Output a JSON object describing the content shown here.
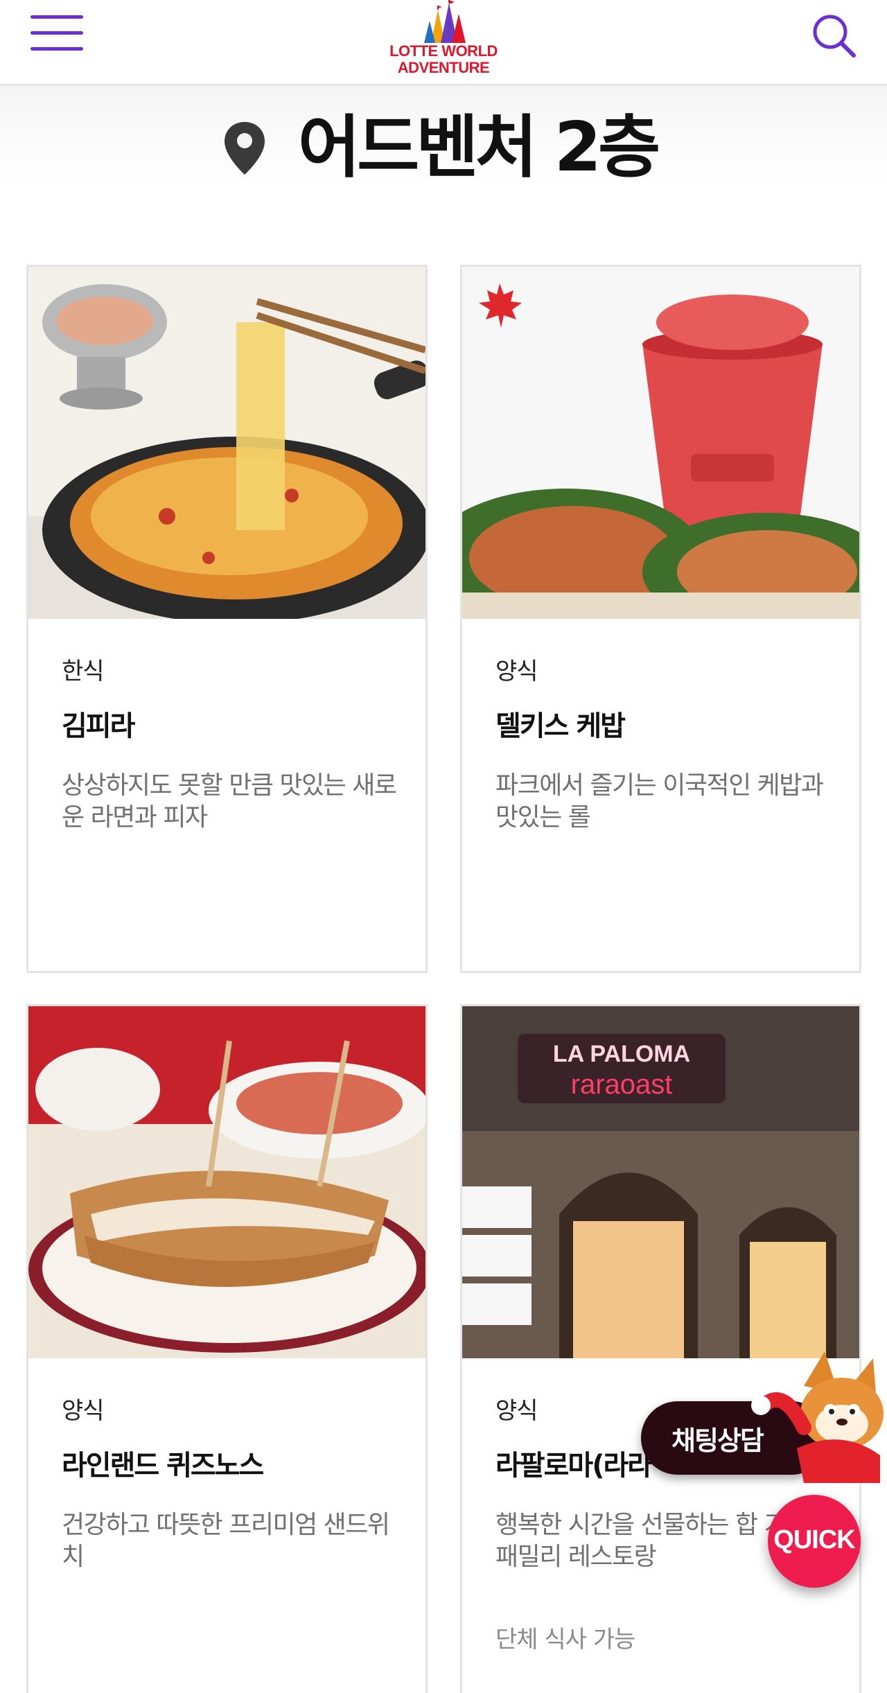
{
  "header": {
    "logo_line1": "LOTTE WORLD",
    "logo_line2": "ADVENTURE",
    "menu_icon": "hamburger-menu-icon",
    "search_icon": "search-icon"
  },
  "page": {
    "title": "어드벤처 2층",
    "title_icon": "location-pin-icon"
  },
  "restaurants": [
    {
      "category": "한식",
      "name": "김피라",
      "description": "상상하지도 못할 만큼 맛있는 새로운 라면과 피자",
      "image": "cheese-tteokbokki-pan-photo"
    },
    {
      "category": "양식",
      "name": "델키스 케밥",
      "description": "파크에서 즐기는 이국적인 케밥과 맛있는 롤",
      "image": "kebab-wrap-and-drink-photo",
      "badge_icon": "maple-leaf-icon"
    },
    {
      "category": "양식",
      "name": "라인랜드 퀴즈노스",
      "description": "건강하고 따뜻한 프리미엄 샌드위치",
      "image": "sub-sandwich-photo"
    },
    {
      "category": "양식",
      "name": "라팔로마(라라",
      "description": "행복한 시간을 선물하는 합 가격의 패밀리 레스토랑",
      "note": "단체 식사 가능",
      "image": "la-paloma-storefront-photo"
    }
  ],
  "floating": {
    "chat_label": "채팅상담",
    "quick_label": "QUICK",
    "mascot": "raccoon-mascot-icon"
  },
  "colors": {
    "brand_purple": "#6b2fd6",
    "brand_red": "#e0162b",
    "quick_red": "#ee1d4d",
    "chat_dark": "#2a0a12",
    "desc_gray": "#707070"
  }
}
